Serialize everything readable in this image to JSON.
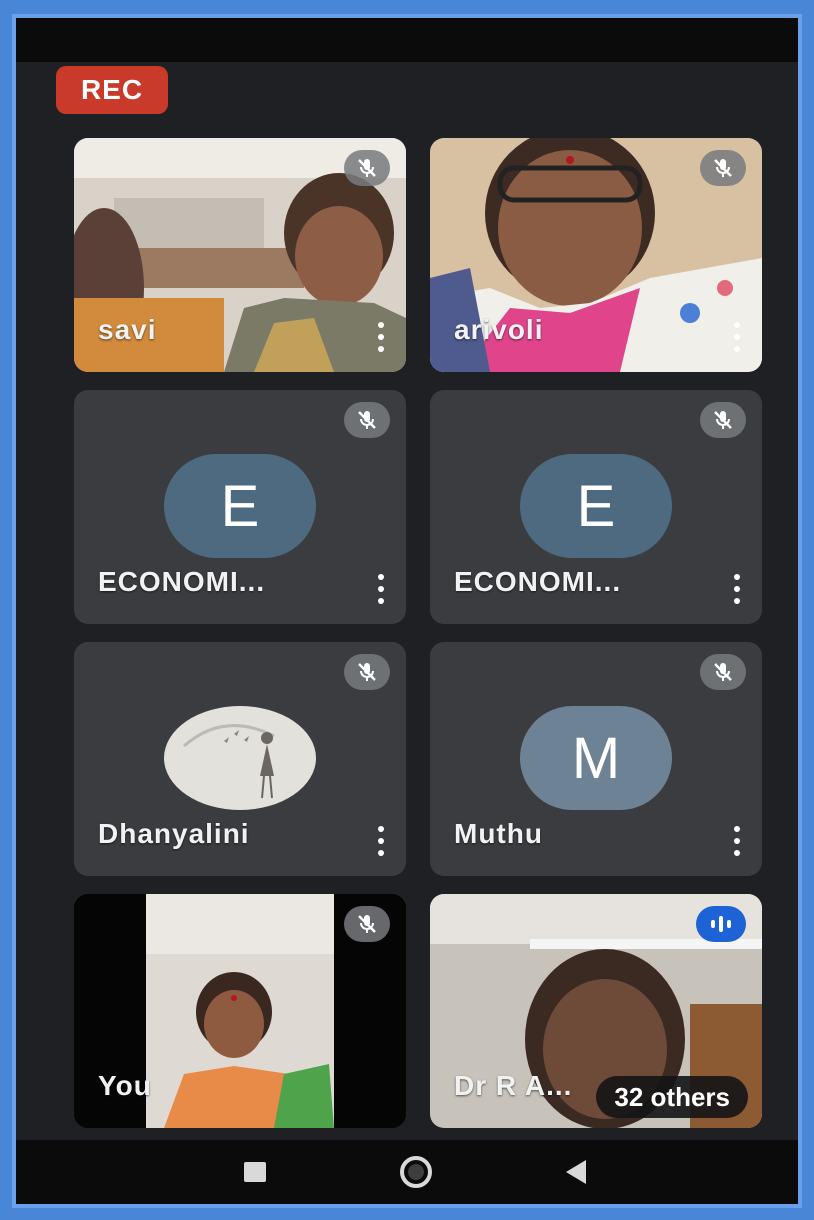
{
  "recording_badge": "REC",
  "participants": [
    {
      "name": "savi"
    },
    {
      "name": "arivoli"
    },
    {
      "name": "ECONOMI...",
      "initial": "E"
    },
    {
      "name": "ECONOMI...",
      "initial": "E"
    },
    {
      "name": "Dhanyalini"
    },
    {
      "name": "Muthu",
      "initial": "M"
    },
    {
      "name": "You"
    },
    {
      "name": "Dr R A..."
    }
  ],
  "others_label": "32 others",
  "icons": {
    "muted": "mic-off-icon",
    "speaking": "audio-level-icon",
    "more": "more-vert-icon",
    "recents": "square-nav-icon",
    "home": "circle-nav-icon",
    "back": "triangle-back-icon"
  },
  "colors": {
    "rec": "#c93a2a",
    "tile": "#3a3c40",
    "avatar_e": "#4e6a80",
    "avatar_m": "#6d8294",
    "speaking": "#1e63d6",
    "frame": "#4a86d6"
  }
}
